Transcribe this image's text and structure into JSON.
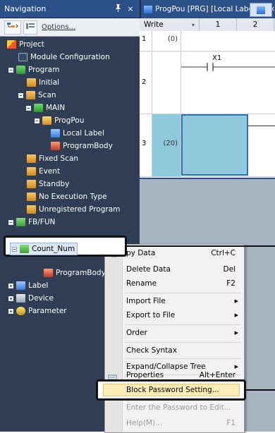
{
  "navigation": {
    "title": "Navigation",
    "pin_icon": "pin-icon",
    "close_label": "×",
    "toolbar": {
      "options_label": "Options..."
    },
    "tree": {
      "project": "Project",
      "module_configuration": "Module Configuration",
      "program": "Program",
      "initial": "Initial",
      "scan": "Scan",
      "main": "MAIN",
      "progpou": "ProgPou",
      "local_label": "Local Label",
      "program_body": "ProgramBody",
      "fixed_scan": "Fixed Scan",
      "event": "Event",
      "standby": "Standby",
      "no_execution_type": "No Execution Type",
      "unregistered_program": "Unregistered Program",
      "fb_fun": "FB/FUN",
      "count_num": "Count_Num",
      "program_body2": "ProgramBody",
      "label": "Label",
      "device": "Device",
      "parameter": "Parameter"
    }
  },
  "editor": {
    "tab_title": "ProgPou [PRG] [Local Label ...",
    "tab_close": "×",
    "mode": "Write",
    "columns": [
      "1",
      "2"
    ],
    "rows": [
      {
        "num": "1",
        "step": "(0)"
      },
      {
        "num": "2",
        "step": ""
      },
      {
        "num": "3",
        "step": "(20)"
      }
    ],
    "contact_label": "X1"
  },
  "context_menu": {
    "items": [
      {
        "label": "py Data",
        "shortcut": "Ctrl+C"
      },
      {
        "label": "Delete Data",
        "shortcut": "Del"
      },
      {
        "label": "Rename",
        "shortcut": "F2"
      },
      {
        "label": "Import File"
      },
      {
        "label": "Export to File"
      },
      {
        "label": "Order"
      },
      {
        "label": "Check Syntax"
      },
      {
        "label": "Expand/Collapse Tree"
      },
      {
        "label": "Properties",
        "shortcut": "Alt+Enter"
      },
      {
        "label": "Block Password Setting..."
      },
      {
        "label": "Enter the Password to Edit..."
      },
      {
        "label": "Help(M)...",
        "shortcut": "F1"
      }
    ]
  }
}
